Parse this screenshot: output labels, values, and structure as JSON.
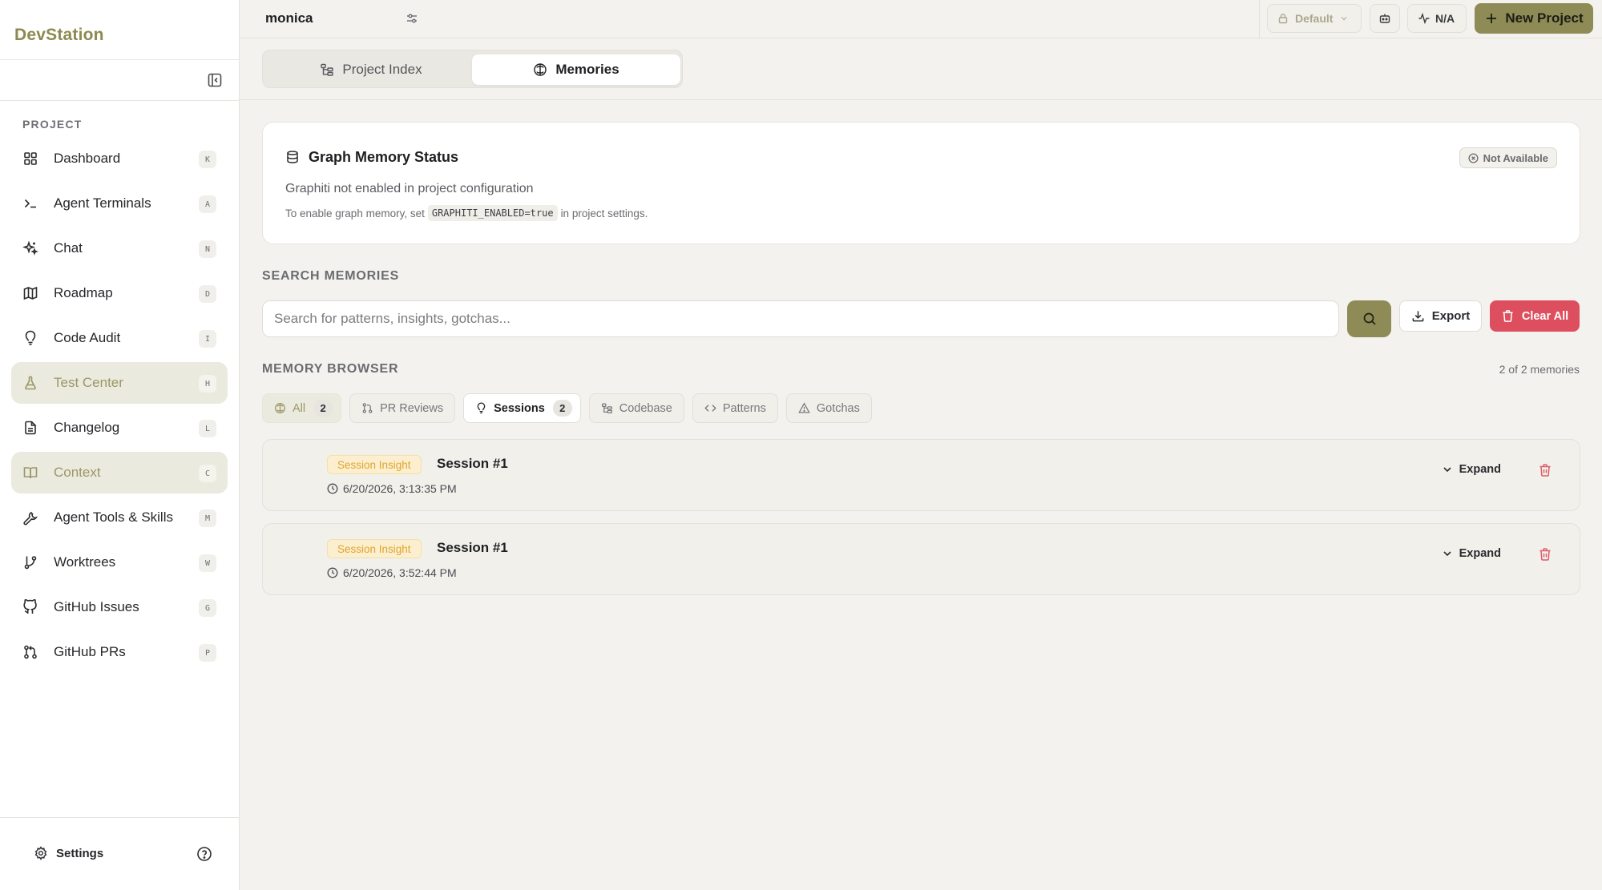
{
  "app": {
    "brand": "DevStation"
  },
  "sidebar": {
    "section_label": "PROJECT",
    "items": [
      {
        "label": "Dashboard",
        "key": "K",
        "icon": "grid-icon",
        "active": false
      },
      {
        "label": "Agent Terminals",
        "key": "A",
        "icon": "terminal-icon",
        "active": false
      },
      {
        "label": "Chat",
        "key": "N",
        "icon": "sparkles-icon",
        "active": false
      },
      {
        "label": "Roadmap",
        "key": "D",
        "icon": "map-icon",
        "active": false
      },
      {
        "label": "Code Audit",
        "key": "I",
        "icon": "lightbulb-icon",
        "active": false
      },
      {
        "label": "Test Center",
        "key": "H",
        "icon": "flask-icon",
        "active": true
      },
      {
        "label": "Changelog",
        "key": "L",
        "icon": "file-text-icon",
        "active": false
      },
      {
        "label": "Context",
        "key": "C",
        "icon": "book-open-icon",
        "active": true
      },
      {
        "label": "Agent Tools & Skills",
        "key": "M",
        "icon": "wrench-icon",
        "active": false
      },
      {
        "label": "Worktrees",
        "key": "W",
        "icon": "git-branch-icon",
        "active": false
      },
      {
        "label": "GitHub Issues",
        "key": "G",
        "icon": "github-icon",
        "active": false
      },
      {
        "label": "GitHub PRs",
        "key": "P",
        "icon": "git-pull-request-icon",
        "active": false
      }
    ],
    "settings_label": "Settings"
  },
  "topbar": {
    "project_tab": "monica",
    "profile": "Default",
    "status": "N/A",
    "new_project": "New Project"
  },
  "tabs": {
    "project_index": "Project Index",
    "memories": "Memories",
    "active": "Memories"
  },
  "status_card": {
    "title": "Graph Memory Status",
    "badge": "Not Available",
    "description": "Graphiti not enabled in project configuration",
    "hint_prefix": "To enable graph memory, set",
    "hint_code": "GRAPHITI_ENABLED=true",
    "hint_suffix": "in project settings."
  },
  "search": {
    "label": "SEARCH MEMORIES",
    "placeholder": "Search for patterns, insights, gotchas...",
    "value": "",
    "export_label": "Export",
    "clear_label": "Clear All"
  },
  "browser": {
    "label": "MEMORY BROWSER",
    "count_text": "2 of 2 memories",
    "filters": {
      "all": {
        "label": "All",
        "count": "2"
      },
      "pr_reviews": {
        "label": "PR Reviews"
      },
      "sessions": {
        "label": "Sessions",
        "count": "2"
      },
      "codebase": {
        "label": "Codebase"
      },
      "patterns": {
        "label": "Patterns"
      },
      "gotchas": {
        "label": "Gotchas"
      }
    },
    "memories": [
      {
        "type": "Session Insight",
        "title": "Session #1",
        "timestamp": "6/20/2026, 3:13:35 PM",
        "expand": "Expand"
      },
      {
        "type": "Session Insight",
        "title": "Session #1",
        "timestamp": "6/20/2026, 3:52:44 PM",
        "expand": "Expand"
      }
    ]
  },
  "colors": {
    "accent": "#8e8b56",
    "active_text": "#9a9766",
    "danger": "#dd4f5e",
    "insight_text": "#e2a42b",
    "insight_bg": "#fbefd0"
  }
}
